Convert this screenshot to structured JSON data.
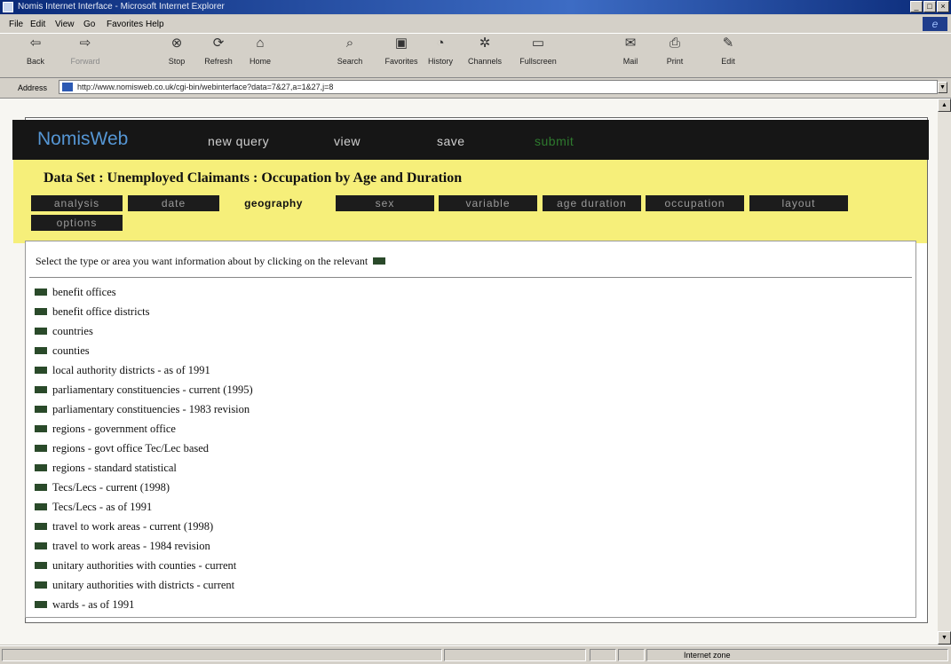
{
  "window": {
    "title": "Nomis Internet Interface - Microsoft Internet Explorer",
    "controls": [
      "_",
      "□",
      "×"
    ]
  },
  "menubar": [
    "File",
    "Edit",
    "View",
    "Go",
    "Favorites",
    "Help"
  ],
  "toolbar": [
    {
      "label": "Back",
      "icon": "back-arrow"
    },
    {
      "label": "Forward",
      "icon": "forward-arrow"
    },
    {
      "label": "Stop",
      "icon": "stop"
    },
    {
      "label": "Refresh",
      "icon": "refresh"
    },
    {
      "label": "Home",
      "icon": "home"
    },
    {
      "label": "Search",
      "icon": "search"
    },
    {
      "label": "Favorites",
      "icon": "favorites"
    },
    {
      "label": "History",
      "icon": "history"
    },
    {
      "label": "Channels",
      "icon": "channels"
    },
    {
      "label": "Fullscreen",
      "icon": "fullscreen"
    },
    {
      "label": "Mail",
      "icon": "mail"
    },
    {
      "label": "Print",
      "icon": "print"
    },
    {
      "label": "Edit",
      "icon": "edit"
    }
  ],
  "address": {
    "label": "Address",
    "url": "http://www.nomisweb.co.uk/cgi-bin/webinterface?data=7&27,a=1&27,j=8"
  },
  "site": {
    "brand_a": "Nomis",
    "brand_b": "Web",
    "nav": [
      "new query",
      "view",
      "save",
      "submit"
    ]
  },
  "dataset_title": "Data Set : Unemployed Claimants : Occupation by Age and Duration",
  "tabs": [
    "analysis",
    "date",
    "geography",
    "sex",
    "variable",
    "age duration",
    "occupation",
    "layout",
    "options"
  ],
  "active_tab": "geography",
  "instruction": "Select the type or area you want information about by clicking on the relevant",
  "geography_types": [
    "benefit offices",
    "benefit office districts",
    "countries",
    "counties",
    "local authority districts - as of 1991",
    "parliamentary constituencies - current (1995)",
    "parliamentary constituencies - 1983 revision",
    "regions - government office",
    "regions - govt office Tec/Lec based",
    "regions - standard statistical",
    "Tecs/Lecs - current (1998)",
    "Tecs/Lecs - as of 1991",
    "travel to work areas - current (1998)",
    "travel to work areas - 1984 revision",
    "unitary authorities with counties - current",
    "unitary authorities with districts - current",
    "wards - as of 1991"
  ],
  "status": {
    "zone": "Internet zone"
  },
  "colors": {
    "site_bar": "#161616",
    "panel": "#f6ef7a",
    "tab_bg": "#1c1c1c",
    "bullet": "#2a4a2a"
  }
}
